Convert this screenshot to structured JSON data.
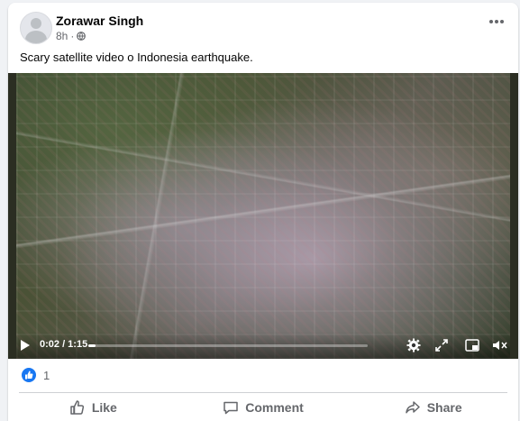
{
  "post": {
    "author": "Zorawar Singh",
    "timestamp": "8h",
    "privacy_icon": "globe-icon",
    "caption": "Scary satellite video o Indonesia earthquake."
  },
  "video": {
    "time_display": "0:02 / 1:15",
    "progress": 0.027,
    "controls": [
      "play-icon",
      "settings-icon",
      "fullscreen-icon",
      "miniplayer-icon",
      "volume-icon"
    ]
  },
  "reactions": {
    "icon": "like-icon",
    "count": "1"
  },
  "actions": {
    "like_label": "Like",
    "comment_label": "Comment",
    "share_label": "Share"
  },
  "colors": {
    "accent": "#1877f2",
    "secondary_text": "#65676b"
  }
}
